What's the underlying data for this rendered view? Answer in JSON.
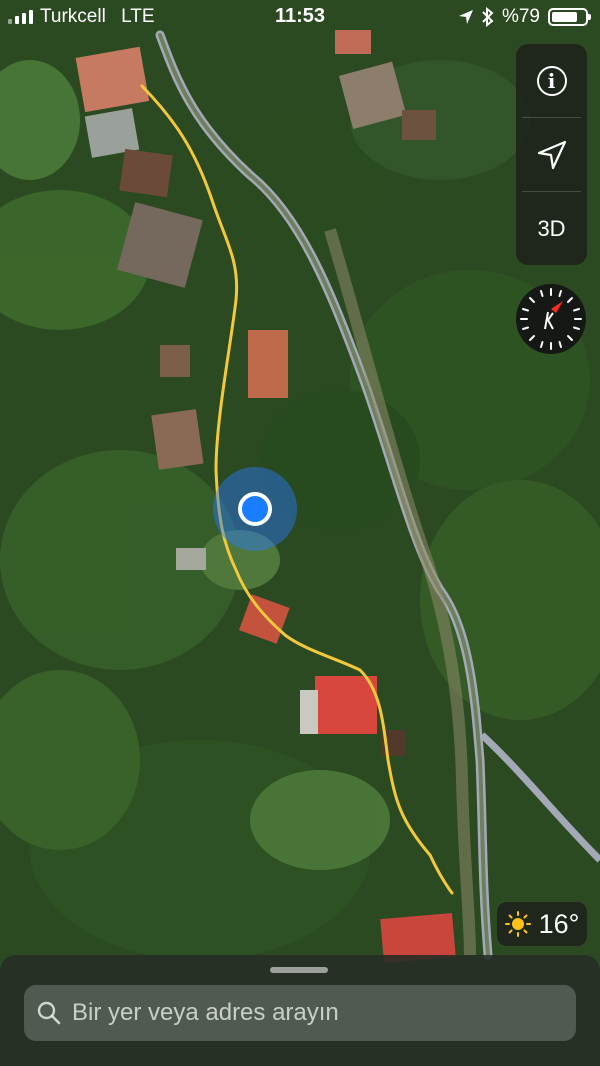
{
  "status_bar": {
    "carrier": "Turkcell",
    "network": "LTE",
    "time": "11:53",
    "battery": "%79",
    "battery_level": 0.79
  },
  "map_controls": {
    "info": "i",
    "mode_3d": "3D"
  },
  "weather": {
    "temperature": "16°"
  },
  "search": {
    "placeholder": "Bir yer veya adres arayın",
    "value": ""
  },
  "colors": {
    "route": "#f2c83c",
    "location_dot": "#1a7cff",
    "compass_needle": "#ff2b1f",
    "road": "#a3a9b6"
  }
}
